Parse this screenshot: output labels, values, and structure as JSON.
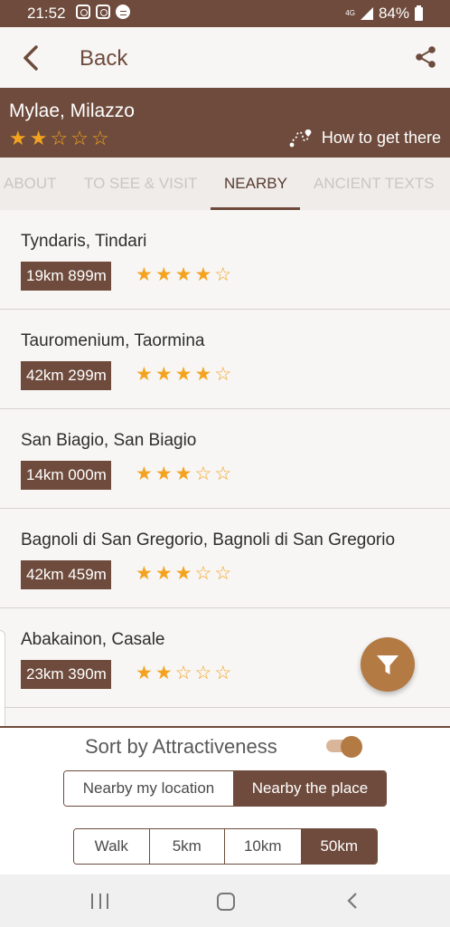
{
  "status_bar": {
    "time": "21:52",
    "network": "4G",
    "battery": "84%"
  },
  "app_bar": {
    "back_label": "Back"
  },
  "place": {
    "title": "Mylae, Milazzo",
    "rating": 2,
    "how_to_get_there": "How to get there"
  },
  "tabs": [
    {
      "label": "ABOUT",
      "active": false
    },
    {
      "label": "TO SEE & VISIT",
      "active": false
    },
    {
      "label": "NEARBY",
      "active": true
    },
    {
      "label": "ANCIENT TEXTS",
      "active": false
    }
  ],
  "nearby": [
    {
      "title": "Tyndaris, Tindari",
      "distance": "19km 899m",
      "rating": 4
    },
    {
      "title": "Tauromenium, Taormina",
      "distance": "42km 299m",
      "rating": 4
    },
    {
      "title": "San Biagio, San Biagio",
      "distance": "14km 000m",
      "rating": 3
    },
    {
      "title": "Bagnoli di San Gregorio, Bagnoli di San Gregorio",
      "distance": "42km 459m",
      "rating": 3
    },
    {
      "title": "Abakainon, Casale",
      "distance": "23km 390m",
      "rating": 2
    }
  ],
  "filters": {
    "sort_label": "Sort by Attractiveness",
    "sort_enabled": true,
    "location_options": [
      "Nearby my location",
      "Nearby the place"
    ],
    "location_selected": 1,
    "distance_options": [
      "Walk",
      "5km",
      "10km",
      "50km"
    ],
    "distance_selected": 3
  },
  "colors": {
    "brand": "#6e4b3c",
    "accent": "#b37a44",
    "star": "#f3a31f"
  },
  "icons": {
    "back": "chevron-left-icon",
    "share": "share-icon",
    "route": "route-icon",
    "filter": "filter-icon"
  }
}
